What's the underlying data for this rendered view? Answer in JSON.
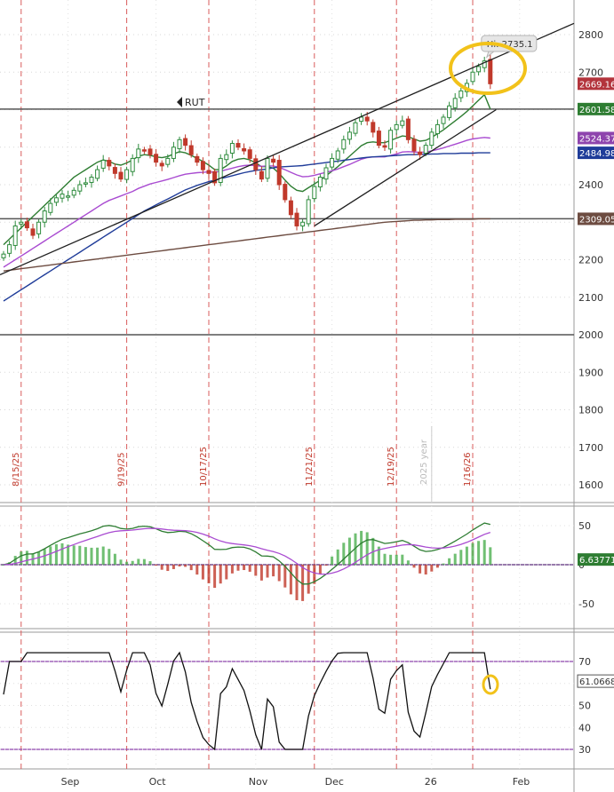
{
  "chart_data": [
    {
      "type": "candlestick",
      "symbol": "RUT",
      "y_ticks": [
        1600,
        1700,
        1800,
        1900,
        2000,
        2100,
        2200,
        2300,
        2400,
        2500,
        2600,
        2700,
        2800
      ],
      "ylim": [
        1550,
        2900
      ],
      "x_labels": [
        "Sep",
        "Oct",
        "Nov",
        "Dec",
        "26",
        "Feb"
      ],
      "event_markers": [
        "8/15/25",
        "9/19/25",
        "10/17/25",
        "11/21/25",
        "12/19/25",
        "1/16/26"
      ],
      "year_marker": "2025 year",
      "high_marker": "Hi: 2735.1",
      "price_badges": [
        {
          "label": "2669.16",
          "value": 2669.16,
          "color": "#b3343c"
        },
        {
          "label": "2601.58",
          "value": 2601.58,
          "color": "#2e7d32"
        },
        {
          "label": "2524.37",
          "value": 2524.37,
          "color": "#8e44ad"
        },
        {
          "label": "2484.98",
          "value": 2484.98,
          "color": "#1f3c99"
        },
        {
          "label": "2309.05",
          "value": 2309.05,
          "color": "#6d4c41"
        }
      ],
      "horizontal_levels": [
        2601.58,
        2309.05,
        2000
      ],
      "series": [
        {
          "values": [
            2215,
            2240,
            2290,
            2300,
            2285,
            2265,
            2300,
            2330,
            2350,
            2365,
            2375,
            2370,
            2385,
            2400,
            2405,
            2420,
            2440,
            2465,
            2450,
            2430,
            2415,
            2440,
            2470,
            2495,
            2490,
            2480,
            2460,
            2450,
            2470,
            2500,
            2520,
            2505,
            2480,
            2460,
            2440,
            2430,
            2405,
            2470,
            2480,
            2510,
            2500,
            2490,
            2470,
            2440,
            2415,
            2470,
            2460,
            2400,
            2360,
            2320,
            2290,
            2300,
            2360,
            2395,
            2420,
            2445,
            2470,
            2490,
            2520,
            2540,
            2565,
            2580,
            2570,
            2540,
            2505,
            2500,
            2545,
            2560,
            2570,
            2520,
            2490,
            2480,
            2505,
            2540,
            2560,
            2580,
            2610,
            2630,
            2650,
            2670,
            2700,
            2715,
            2730,
            2669
          ]
        },
        {
          "name": "",
          "values": [
            2240,
            2255,
            2270,
            2285,
            2300,
            2315,
            2330,
            2345,
            2360,
            2375,
            2390,
            2405,
            2420,
            2430,
            2440,
            2450,
            2460,
            2466,
            2462,
            2455,
            2452,
            2458,
            2466,
            2476,
            2480,
            2478,
            2474,
            2472,
            2475,
            2482,
            2488,
            2485,
            2478,
            2470,
            2462,
            2452,
            2440,
            2440,
            2450,
            2462,
            2468,
            2470,
            2466,
            2458,
            2448,
            2448,
            2444,
            2430,
            2412,
            2396,
            2385,
            2382,
            2392,
            2402,
            2412,
            2424,
            2436,
            2448,
            2462,
            2476,
            2490,
            2504,
            2512,
            2514,
            2512,
            2512,
            2518,
            2524,
            2530,
            2528,
            2522,
            2516,
            2518,
            2526,
            2536,
            2546,
            2558,
            2570,
            2582,
            2595,
            2610,
            2625,
            2640,
            2601.58
          ]
        },
        {
          "name": "",
          "values": [
            2180,
            2190,
            2200,
            2210,
            2220,
            2230,
            2240,
            2250,
            2260,
            2270,
            2280,
            2290,
            2300,
            2310,
            2320,
            2330,
            2340,
            2350,
            2358,
            2364,
            2370,
            2376,
            2382,
            2390,
            2396,
            2402,
            2406,
            2410,
            2414,
            2419,
            2424,
            2428,
            2430,
            2432,
            2433,
            2434,
            2433,
            2436,
            2440,
            2444,
            2448,
            2451,
            2452,
            2451,
            2449,
            2450,
            2450,
            2446,
            2440,
            2433,
            2426,
            2421,
            2422,
            2425,
            2429,
            2433,
            2437,
            2442,
            2448,
            2454,
            2461,
            2468,
            2472,
            2474,
            2474,
            2474,
            2478,
            2482,
            2487,
            2488,
            2487,
            2486,
            2487,
            2490,
            2494,
            2498,
            2503,
            2508,
            2513,
            2518,
            2522,
            2524,
            2526,
            2524.37
          ]
        },
        {
          "name": "",
          "values": [
            2090,
            2100,
            2110,
            2120,
            2130,
            2140,
            2150,
            2160,
            2170,
            2180,
            2190,
            2200,
            2210,
            2220,
            2230,
            2240,
            2250,
            2260,
            2270,
            2280,
            2290,
            2300,
            2310,
            2320,
            2330,
            2338,
            2346,
            2354,
            2362,
            2370,
            2378,
            2386,
            2392,
            2398,
            2403,
            2408,
            2412,
            2416,
            2420,
            2424,
            2428,
            2432,
            2435,
            2438,
            2440,
            2442,
            2445,
            2447,
            2448,
            2449,
            2450,
            2451,
            2453,
            2455,
            2457,
            2459,
            2461,
            2463,
            2465,
            2467,
            2469,
            2471,
            2473,
            2474,
            2475,
            2476,
            2477,
            2478,
            2479,
            2480,
            2480,
            2481,
            2481,
            2482,
            2482,
            2483,
            2483,
            2483,
            2484,
            2484,
            2484,
            2485,
            2485,
            2484.98
          ]
        },
        {
          "name": "",
          "values": [
            2170,
            2172,
            2174,
            2176,
            2178,
            2180,
            2182,
            2184,
            2186,
            2188,
            2190,
            2192,
            2194,
            2196,
            2198,
            2200,
            2202,
            2204,
            2206,
            2208,
            2210,
            2212,
            2214,
            2216,
            2218,
            2220,
            2222,
            2224,
            2226,
            2228,
            2230,
            2232,
            2234,
            2236,
            2238,
            2240,
            2242,
            2244,
            2246,
            2248,
            2250,
            2252,
            2254,
            2256,
            2258,
            2260,
            2262,
            2264,
            2266,
            2268,
            2270,
            2272,
            2274,
            2276,
            2278,
            2280,
            2282,
            2284,
            2286,
            2288,
            2290,
            2292,
            2294,
            2296,
            2298,
            2300,
            2301,
            2302,
            2303,
            2304,
            2305,
            2305,
            2306,
            2306,
            2307,
            2307,
            2307,
            2308,
            2308,
            2308,
            2308,
            2309,
            2309,
            2309.05
          ]
        }
      ]
    },
    {
      "type": "line",
      "panel": "macd",
      "y_ticks": [
        50,
        0,
        -50
      ],
      "ylim": [
        -80,
        80
      ],
      "badge": {
        "label": "6.63771",
        "value": 6.63771,
        "color": "#2e7d32"
      }
    },
    {
      "type": "line",
      "panel": "rsi",
      "y_ticks": [
        70,
        60,
        50,
        40,
        30
      ],
      "ylim": [
        25,
        76
      ],
      "levels": [
        70,
        30
      ],
      "badge": {
        "label": "61.0668",
        "value": 61.0668,
        "color": "#333333"
      }
    }
  ]
}
